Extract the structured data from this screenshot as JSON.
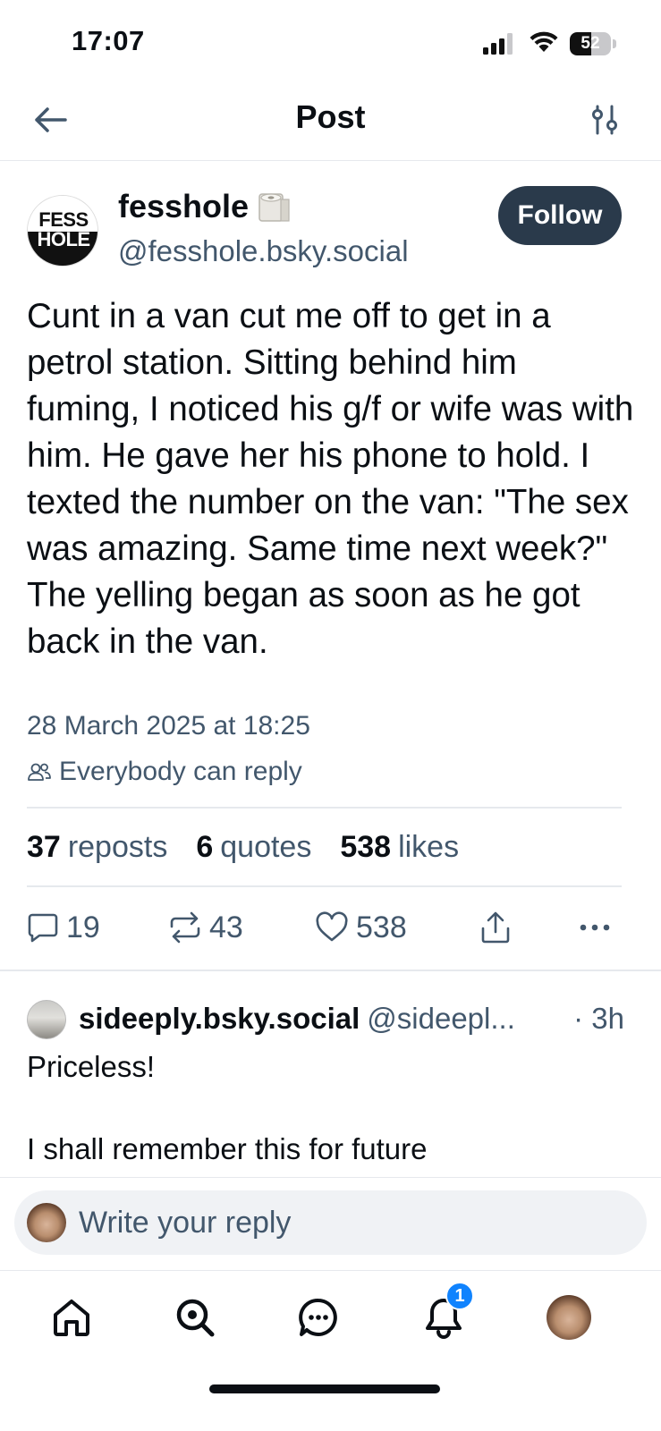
{
  "status_bar": {
    "time": "17:07",
    "battery": "52",
    "battery_level": 0.52
  },
  "header": {
    "title": "Post"
  },
  "post": {
    "avatar_text_top": "FESS",
    "avatar_text_bottom": "HOLE",
    "display_name": "fesshole",
    "name_emoji": "toilet-roll-icon",
    "handle": "@fesshole.bsky.social",
    "follow_label": "Follow",
    "text": "Cunt in a van cut me off to get in a petrol station. Sitting behind him fuming, I noticed his g/f or wife was with him. He gave her his phone to hold. I texted the number on the van: \"The sex was amazing. Same time next week?\" The yelling began as soon as he got back in the van.",
    "date": "28 March 2025 at 18:25",
    "reply_setting": "Everybody can reply",
    "stats": {
      "reposts_count": "37",
      "reposts_label": "reposts",
      "quotes_count": "6",
      "quotes_label": "quotes",
      "likes_count": "538",
      "likes_label": "likes"
    },
    "actions": {
      "replies": "19",
      "reposts": "43",
      "likes": "538"
    }
  },
  "reply": {
    "name": "sideeply.bsky.social",
    "handle": "@sideepl...",
    "time": "· 3h",
    "line1": "Priceless!",
    "line2": "I shall remember this for future"
  },
  "composer": {
    "placeholder": "Write your reply"
  },
  "tab_bar": {
    "notifications_badge": "1"
  },
  "colors": {
    "accent": "#1083fe",
    "follow_bg": "#2a3a4b",
    "muted_text": "#42576c"
  }
}
